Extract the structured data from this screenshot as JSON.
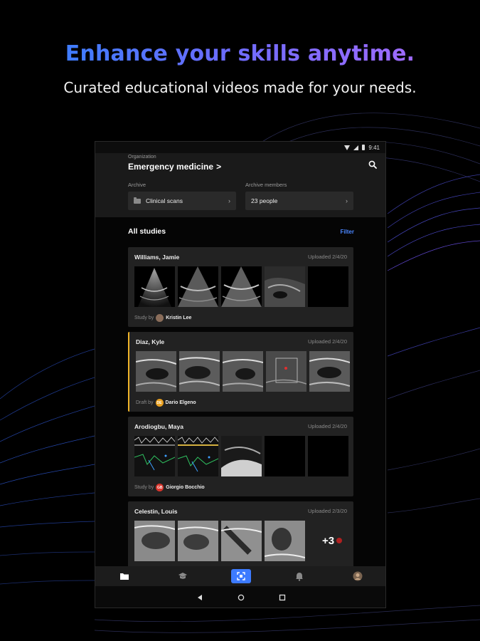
{
  "marketing": {
    "headline": "Enhance your skills anytime.",
    "subheadline": "Curated educational videos made for your needs."
  },
  "status_bar": {
    "time": "9:41"
  },
  "header": {
    "org_label": "Organization",
    "org_name": "Emergency medicine",
    "archive_label": "Archive",
    "archive_value": "Clinical scans",
    "members_label": "Archive members",
    "members_value": "23 people"
  },
  "studies": {
    "title": "All studies",
    "filter_label": "Filter",
    "items": [
      {
        "name": "Williams, Jamie",
        "date": "Uploaded 2/4/20",
        "status_label": "Study by",
        "person": "Kristin Lee",
        "avatar_initials": "",
        "avatar_color": "#8a6d5a",
        "accent": false,
        "thumb_count": 4
      },
      {
        "name": "Diaz, Kyle",
        "date": "Uploaded 2/4/20",
        "status_label": "Draft by",
        "person": "Dario Elgeno",
        "avatar_initials": "DE",
        "avatar_color": "#e8a020",
        "accent": true,
        "thumb_count": 5
      },
      {
        "name": "Arodiogbu, Maya",
        "date": "Uploaded 2/4/20",
        "status_label": "Study by",
        "person": "Giorgio Bocchio",
        "avatar_initials": "GB",
        "avatar_color": "#d9342b",
        "accent": false,
        "thumb_count": 3
      },
      {
        "name": "Celestin, Louis",
        "date": "Uploaded 2/3/20",
        "status_label": "",
        "person": "",
        "avatar_initials": "",
        "avatar_color": "",
        "accent": false,
        "thumb_count": 5,
        "more_label": "+3"
      }
    ]
  },
  "bottom_nav": {
    "items": [
      "folder-icon",
      "graduation-cap-icon",
      "scan-icon",
      "bell-icon",
      "profile-avatar"
    ],
    "active_index": 2,
    "accent_color": "#3d7bff"
  },
  "system_nav": [
    "back-icon",
    "home-icon",
    "recents-icon"
  ],
  "colors": {
    "accent_blue": "#4a86ff",
    "draft_accent": "#f0b429",
    "card_bg": "#222222"
  }
}
